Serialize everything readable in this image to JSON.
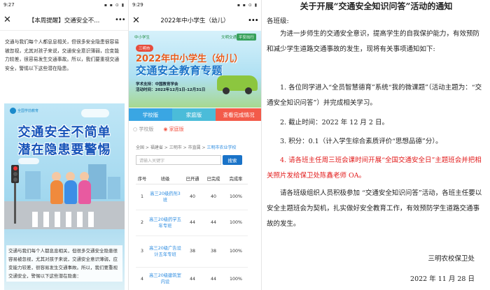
{
  "phone1": {
    "status_time": "9:27",
    "status_icons": "▪ ▪ ⊙ ▮",
    "nav_title": "【本周提醒】交通安全不...",
    "intro": "交通与我们每个人都息息相关，但很多安全隐患很容易被忽视，尤其对孩子来说，交通安全意识薄弱，应变能力较差，很容易发生交通事故。所以，我们要重视交通安全，警惕以下这些潜在隐患。",
    "poster": {
      "logo": "全国学前教育",
      "headline1": "交通安全不简单",
      "headline2": "潜在隐患要警惕",
      "caption": "交通与我们每个人都息息相关，但很多交通安全隐患很容易被忽视，尤其对孩子来说，交通安全意识薄弱，应变能力较差，很容易发生交通事故。所以，我们要重视交通安全，警惕以下这些潜在隐患："
    }
  },
  "phone2": {
    "status_time": "9:29",
    "status_icons": "▪ ▪ ⊙ ▮",
    "nav_title": "2022年中小学生（幼儿）",
    "banner": {
      "brand1": "中小学生",
      "brand2": "文明交通",
      "brand3": "平安出行",
      "pill": "三明市",
      "title1": "2022年中小学生（幼儿）",
      "title2": "交通安全教育专题",
      "meta1": "学术支持：中国教育学会",
      "meta2": "活动时间：2022年12月1日-12月31日"
    },
    "tabs": [
      "学校版",
      "家庭版",
      "查看完成情况"
    ],
    "radios": [
      "学校版",
      "家庭版"
    ],
    "breadcrumb": [
      "全国",
      "福建省",
      "三明市",
      "市直属",
      "三明市农业学校"
    ],
    "search_placeholder": "请输入关键字",
    "search_button": "搜索",
    "table": {
      "headers": [
        "序号",
        "班级",
        "已开通",
        "已完成",
        "完成率"
      ],
      "rows": [
        {
          "idx": "1",
          "cls": "高三20级药剂3班",
          "opened": "40",
          "done": "40",
          "rate": "100%"
        },
        {
          "idx": "2",
          "cls": "高三20级药学五年专班",
          "opened": "44",
          "done": "44",
          "rate": "100%"
        },
        {
          "idx": "3",
          "cls": "高三20级广告设计五年专班",
          "opened": "38",
          "done": "38",
          "rate": "100%"
        },
        {
          "idx": "4",
          "cls": "高三20级建筑室内设",
          "opened": "44",
          "done": "44",
          "rate": "100%"
        }
      ]
    }
  },
  "notice": {
    "title": "关于开展“交通安全知识问答”活动的通知",
    "to": "各班级:",
    "p1": "为进一步师生的交通安全意识，提高学生的自我保护能力，有效预防和减少学生道路交通事故的发生，现将有关事项通知如下:",
    "item1": "1.  各位同学进入“全员智慧德育”系统“我的微课题”（活动主题为：“交通安全知识问答”）并完成相关学习。",
    "item2": "2.  截止时间：2022 年 12 月 2 日。",
    "item3": "3.  积分：0.1（计入学生综合素质评价“思想品德”分）。",
    "item4": "4. 请各班主任周三班会课时间开展“全国交通安全日”主题班会并把相关照片发给保卫处陈鑫老师 OA。",
    "p2": "请各班级组织人员积极参加 “交通安全知识问答”活动，各班主任要以安全主题班会为契机，扎实做好安全教育工作，有效预防学生道路交通事故的发生。",
    "signature": "三明农校保卫处",
    "date": "2022 年 11 月 28 日"
  }
}
